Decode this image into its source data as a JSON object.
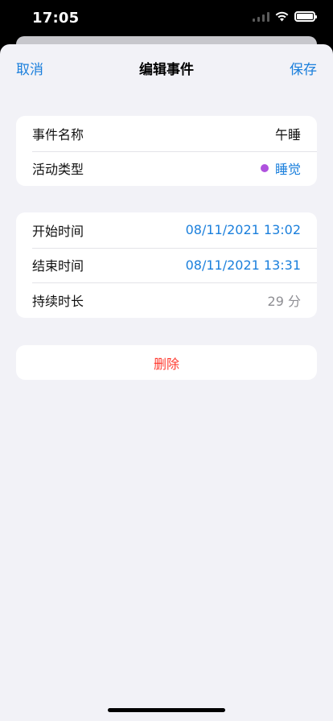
{
  "status_bar": {
    "time": "17:05",
    "icons": [
      "signal-icon",
      "wifi-icon",
      "battery-icon"
    ]
  },
  "nav": {
    "cancel": "取消",
    "title": "编辑事件",
    "save": "保存"
  },
  "event_group": {
    "name_label": "事件名称",
    "name_value": "午睡",
    "type_label": "活动类型",
    "type_value": "睡觉",
    "type_color": "#af52de"
  },
  "time_group": {
    "start_label": "开始时间",
    "start_value": "08/11/2021 13:02",
    "end_label": "结束时间",
    "end_value": "08/11/2021 13:31",
    "duration_label": "持续时长",
    "duration_value": "29 分"
  },
  "delete": {
    "label": "删除"
  },
  "colors": {
    "accent": "#1a7fdc",
    "destructive": "#ff3b30",
    "background": "#f2f2f7"
  }
}
